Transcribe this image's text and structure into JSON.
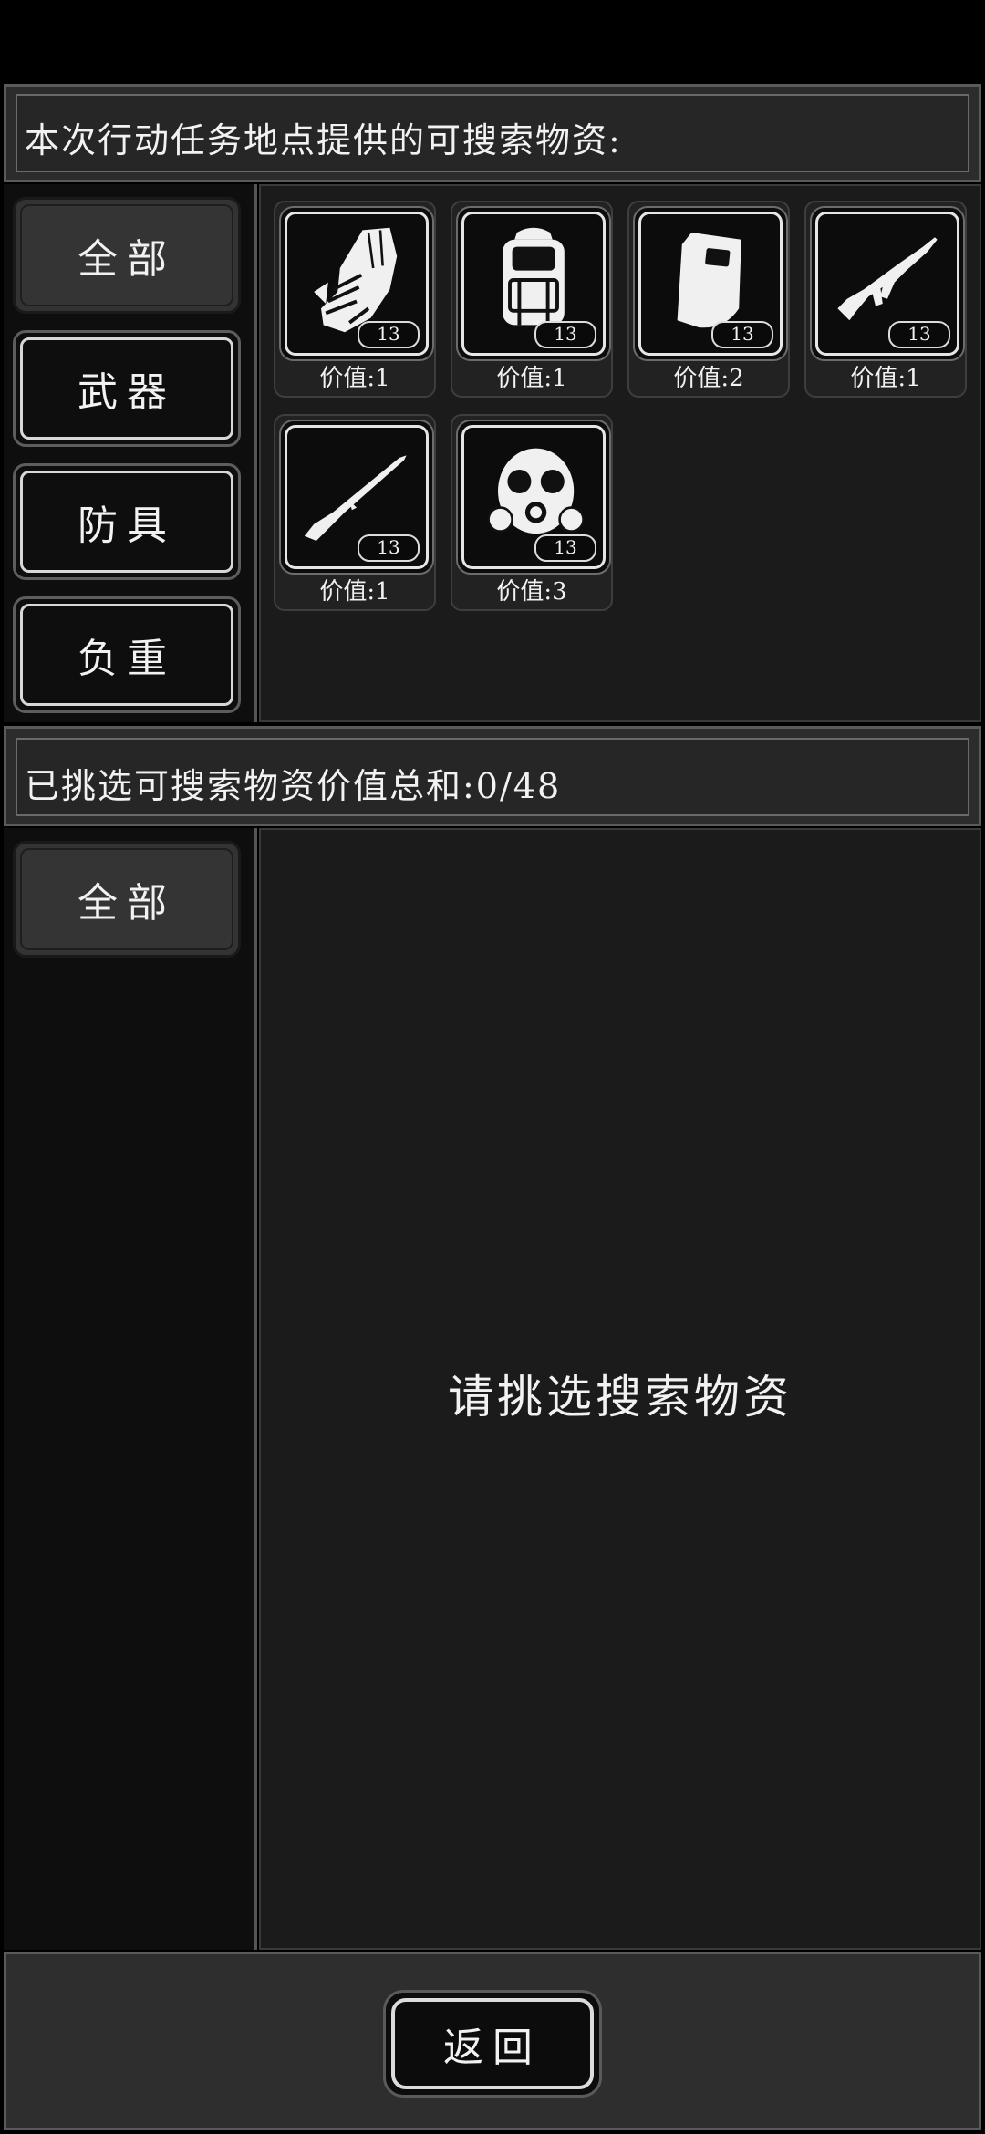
{
  "top_panel": {
    "header": "本次行动任务地点提供的可搜索物资:",
    "categories": [
      {
        "label": "全部",
        "active": true
      },
      {
        "label": "武器",
        "active": false
      },
      {
        "label": "防具",
        "active": false
      },
      {
        "label": "负重",
        "active": false
      }
    ],
    "items": [
      {
        "icon": "gauntlet-icon",
        "count": "13",
        "value_text": "价值:1"
      },
      {
        "icon": "backpack-icon",
        "count": "13",
        "value_text": "价值:1"
      },
      {
        "icon": "riot-shield-icon",
        "count": "13",
        "value_text": "价值:2"
      },
      {
        "icon": "assault-rifle-icon",
        "count": "13",
        "value_text": "价值:1"
      },
      {
        "icon": "bolt-rifle-icon",
        "count": "13",
        "value_text": "价值:1"
      },
      {
        "icon": "gas-mask-icon",
        "count": "13",
        "value_text": "价值:3"
      }
    ]
  },
  "bottom_panel": {
    "header": "已挑选可搜索物资价值总和:0/48",
    "categories": [
      {
        "label": "全部",
        "active": true
      }
    ],
    "empty_text": "请挑选搜索物资"
  },
  "footer": {
    "back_label": "返回"
  },
  "colors": {
    "background": "#000000",
    "panel": "#2c2c2c",
    "sidebar": "#0e0e0e",
    "item_area": "#1b1b1b",
    "text": "#f2f2f2"
  }
}
